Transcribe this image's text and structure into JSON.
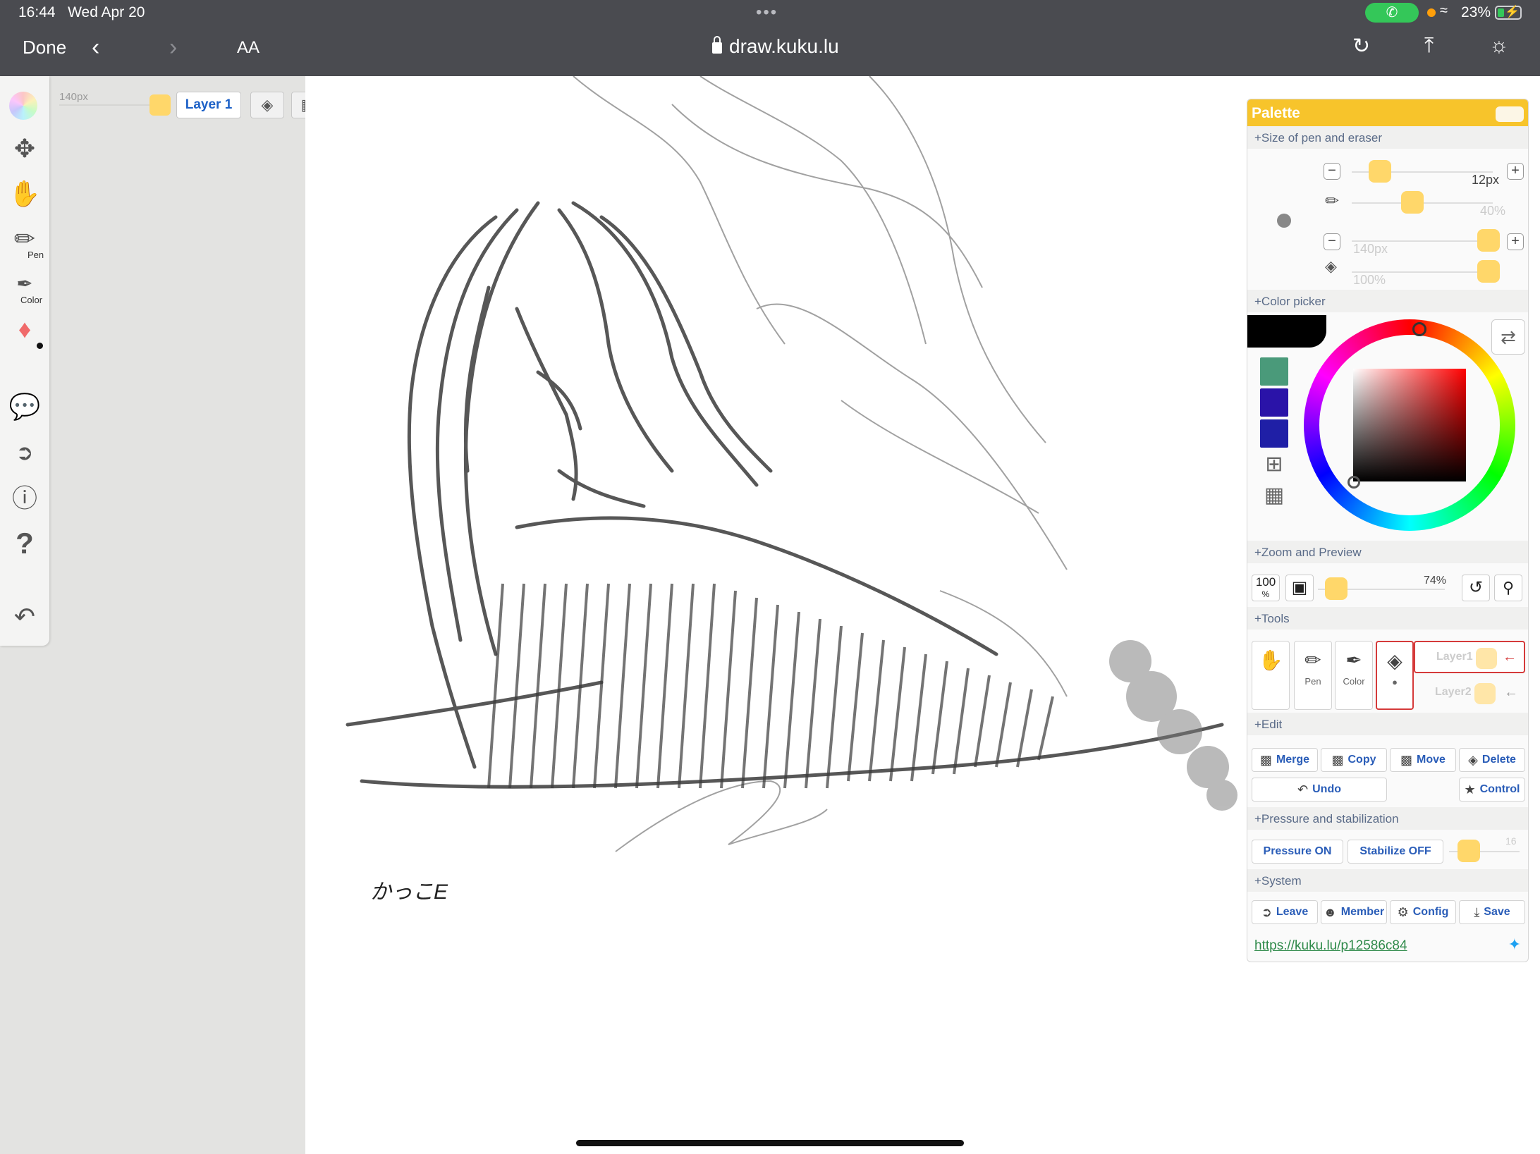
{
  "status_bar": {
    "time": "16:44",
    "date": "Wed Apr 20",
    "battery": "23%",
    "call_icon": "phone-icon"
  },
  "safari": {
    "done_label": "Done",
    "text_size_label": "AA",
    "url": "draw.kuku.lu"
  },
  "toolbar": {
    "pen_label": "Pen",
    "color_label": "Color"
  },
  "layer_bar": {
    "size_label": "140px",
    "layer_name": "Layer 1"
  },
  "canvas": {
    "signature_text": "かっこE",
    "colors": {
      "stroke": "#3a3a3a",
      "light_stroke": "#8a8a8a"
    }
  },
  "palette": {
    "title": "Palette",
    "sections": {
      "size": "+Size of pen and eraser",
      "color": "+Color picker",
      "zoom": "+Zoom and Preview",
      "tools": "+Tools",
      "edit": "+Edit",
      "pressure": "+Pressure and stabilization",
      "system": "+System"
    },
    "pen_size": "12px",
    "pen_opacity": "40%",
    "eraser_size": "140px",
    "eraser_opacity": "100%",
    "zoom_level": "74%",
    "zoom_100_label": "100",
    "zoom_100_sub": "%",
    "stabilize_value": "16",
    "tools": {
      "pen_label": "Pen",
      "color_label": "Color",
      "layer1": "Layer1",
      "layer2": "Layer2"
    },
    "edit_buttons": {
      "merge": "Merge",
      "copy": "Copy",
      "move": "Move",
      "delete": "Delete",
      "undo": "Undo",
      "control": "Control"
    },
    "pressure_button": "Pressure ON",
    "stabilize_button": "Stabilize OFF",
    "system_buttons": {
      "leave": "Leave",
      "member": "Member",
      "config": "Config",
      "save": "Save"
    },
    "link": "https://kuku.lu/p12586c84",
    "swatch_colors": [
      "#4a9a7a",
      "#2a13a8",
      "#1f1fa6"
    ],
    "accent": "#f7c42b"
  }
}
